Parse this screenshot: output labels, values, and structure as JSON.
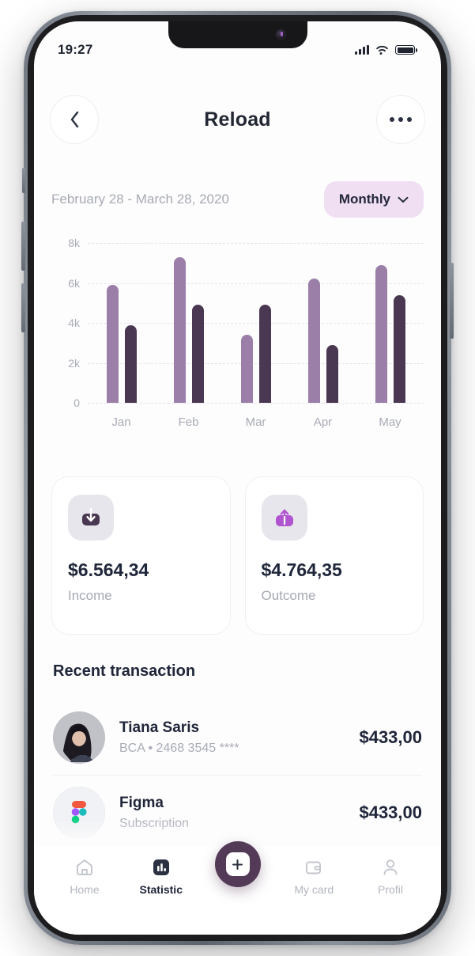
{
  "status_bar": {
    "time": "19:27",
    "signal_icon": "cellular-signal-icon",
    "wifi_icon": "wifi-icon",
    "battery_icon": "battery-icon"
  },
  "header": {
    "title": "Reload",
    "back_icon": "chevron-left-icon",
    "more_icon": "more-horizontal-icon"
  },
  "filter": {
    "date_range": "February 28 - March 28, 2020",
    "period": "Monthly",
    "chevron_icon": "chevron-down-icon"
  },
  "chart_data": {
    "type": "bar",
    "title": "",
    "categories": [
      "Jan",
      "Feb",
      "Mar",
      "Apr",
      "May"
    ],
    "series": [
      {
        "name": "Income",
        "color": "#9b7fa8",
        "values": [
          5900,
          7300,
          3400,
          6200,
          6900
        ]
      },
      {
        "name": "Outcome",
        "color": "#4a3751",
        "values": [
          3900,
          4900,
          4900,
          2900,
          5400
        ]
      }
    ],
    "ytick_labels": [
      "8k",
      "6k",
      "4k",
      "2k",
      "0"
    ],
    "ytick_values": [
      8000,
      6000,
      4000,
      2000,
      0
    ],
    "ylim": [
      0,
      8000
    ],
    "xlabel": "",
    "ylabel": "",
    "grid": true,
    "grid_style": "dashed-horizontal",
    "legend": "none"
  },
  "summary": {
    "income": {
      "amount": "$6.564,34",
      "label": "Income",
      "icon": "download-arrow-icon",
      "icon_color": "#4a3751"
    },
    "outcome": {
      "amount": "$4.764,35",
      "label": "Outcome",
      "icon": "upload-arrow-icon",
      "icon_color": "#b055cf"
    }
  },
  "transactions": {
    "section_title": "Recent transaction",
    "items": [
      {
        "name": "Tiana Saris",
        "subtitle": "BCA • 2468 3545 ****",
        "amount": "$433,00",
        "avatar": "person-photo-avatar"
      },
      {
        "name": "Figma",
        "subtitle": "Subscription",
        "amount": "$433,00",
        "avatar": "figma-logo-icon"
      }
    ]
  },
  "tabbar": {
    "items": [
      {
        "label": "Home",
        "icon": "home-icon",
        "active": false
      },
      {
        "label": "Statistic",
        "icon": "bar-chart-icon",
        "active": true
      },
      {
        "label": "My card",
        "icon": "wallet-icon",
        "active": false
      },
      {
        "label": "Profil",
        "icon": "person-icon",
        "active": false
      }
    ],
    "fab": {
      "icon": "plus-icon"
    }
  },
  "colors": {
    "bar_light": "#9b7fa8",
    "bar_dark": "#4a3751",
    "pill_bg": "#f0dff2",
    "fab_bg": "#533a56",
    "text_dark": "#20263a",
    "text_muted": "#a9acb6"
  }
}
